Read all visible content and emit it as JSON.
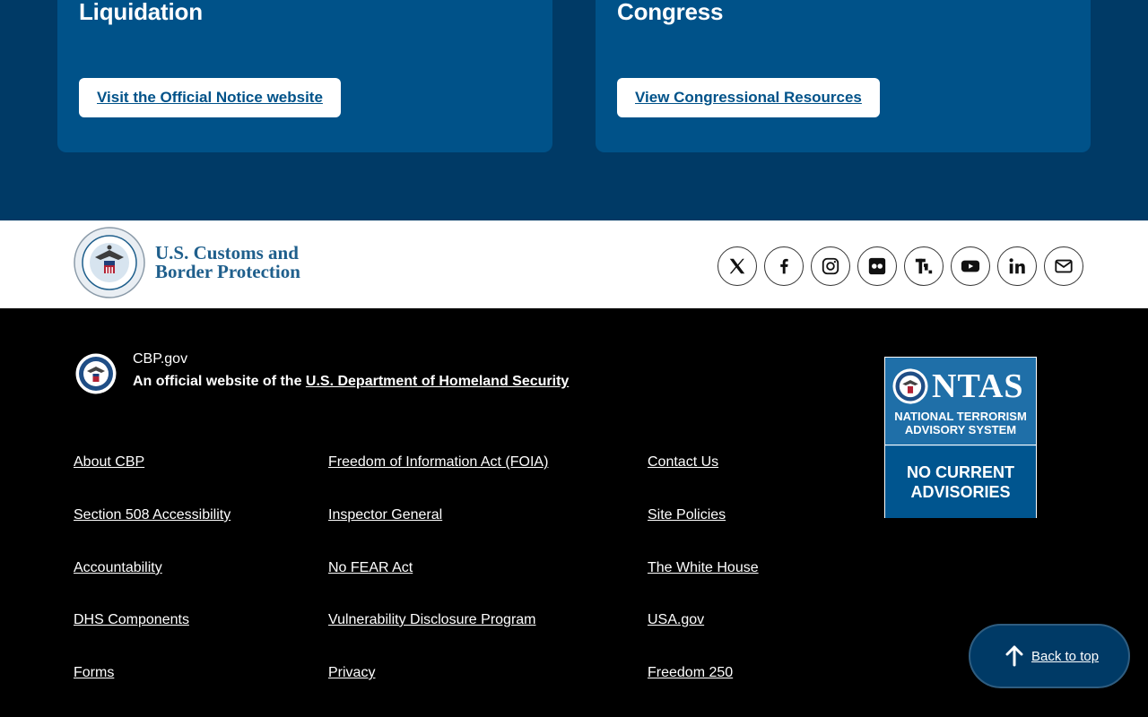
{
  "cards": [
    {
      "title": "Liquidation",
      "button": "Visit the Official Notice website"
    },
    {
      "title": "Congress",
      "button": "View Congressional Resources"
    }
  ],
  "brand": {
    "line1": "U.S. Customs and",
    "line2": "Border Protection"
  },
  "social": [
    {
      "name": "x-twitter-icon"
    },
    {
      "name": "facebook-icon"
    },
    {
      "name": "instagram-icon"
    },
    {
      "name": "flickr-icon"
    },
    {
      "name": "truth-social-icon"
    },
    {
      "name": "youtube-icon"
    },
    {
      "name": "linkedin-icon"
    },
    {
      "name": "email-icon"
    }
  ],
  "footer": {
    "site_name": "CBP.gov",
    "official_prefix": "An official website of the ",
    "official_link": "U.S. Department of Homeland Security",
    "links_col1": [
      "About CBP",
      "Section 508 Accessibility",
      "Accountability",
      "DHS Components",
      "Forms"
    ],
    "links_col2": [
      "Freedom of Information Act (FOIA)",
      "Inspector General",
      "No FEAR Act",
      "Vulnerability Disclosure Program",
      "Privacy"
    ],
    "links_col3": [
      "Contact Us",
      "Site Policies",
      "The White House",
      "USA.gov",
      "Freedom 250"
    ]
  },
  "ntas": {
    "word": "NTAS",
    "sub1": "NATIONAL TERRORISM",
    "sub2": "ADVISORY SYSTEM",
    "adv1": "NO CURRENT",
    "adv2": "ADVISORIES"
  },
  "back_to_top": "Back to top",
  "colors": {
    "primary": "#005289",
    "dark_band": "#003a66",
    "brand_text": "#1f5f8c"
  }
}
